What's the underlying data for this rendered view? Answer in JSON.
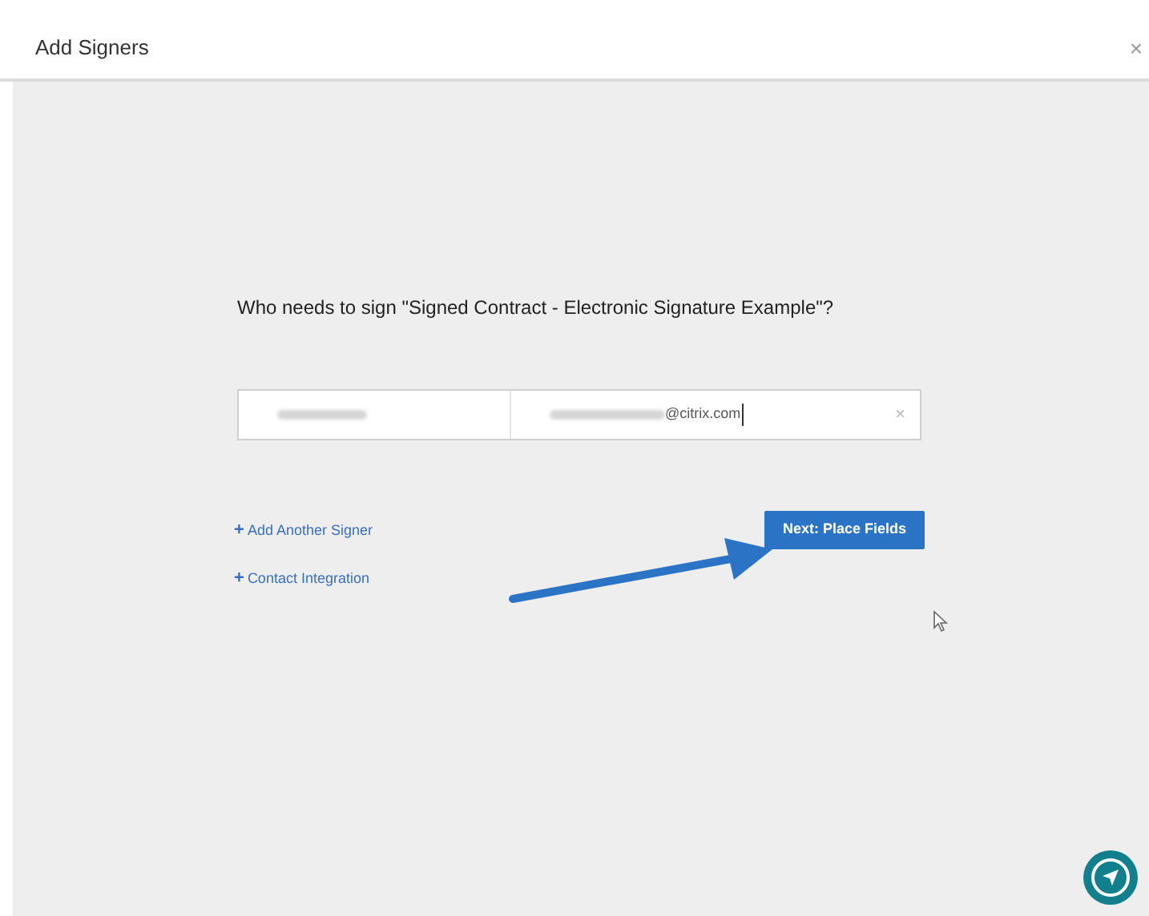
{
  "dialog": {
    "title": "Add Signers",
    "close": "×"
  },
  "prompt": "Who needs to sign \"Signed Contract - Electronic Signature Example\"?",
  "signer": {
    "email_value": "@citrix.com",
    "remove": "×"
  },
  "links": [
    {
      "icon": "+",
      "label": "Add Another Signer"
    },
    {
      "icon": "+",
      "label": "Contact Integration"
    }
  ],
  "next_button": "Next: Place Fields"
}
